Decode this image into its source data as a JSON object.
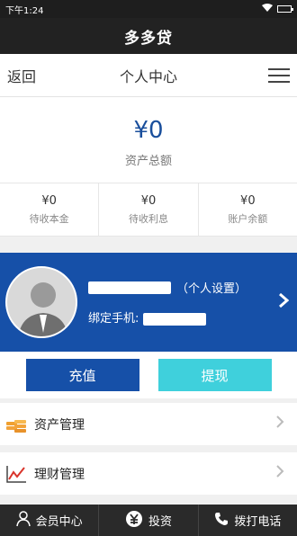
{
  "status": {
    "time": "下午1:24"
  },
  "app": {
    "title": "多多贷"
  },
  "nav": {
    "back": "返回",
    "title": "个人中心"
  },
  "assets": {
    "total_value": "¥0",
    "total_label": "资产总额"
  },
  "stats": [
    {
      "value": "¥0",
      "label": "待收本金"
    },
    {
      "value": "¥0",
      "label": "待收利息"
    },
    {
      "value": "¥0",
      "label": "账户余额"
    }
  ],
  "profile": {
    "settings": "（个人设置）",
    "phone_label": "绑定手机:"
  },
  "buttons": {
    "recharge": "充值",
    "withdraw": "提现"
  },
  "menu": [
    {
      "label": "资产管理",
      "icon": "coins-icon"
    },
    {
      "label": "理财管理",
      "icon": "chart-icon"
    }
  ],
  "tabs": [
    {
      "label": "会员中心",
      "icon": "person-icon"
    },
    {
      "label": "投资",
      "icon": "money-icon"
    },
    {
      "label": "拨打电话",
      "icon": "phone-icon"
    }
  ],
  "colors": {
    "brand_blue": "#1650a8",
    "accent_cyan": "#3fd0dc"
  }
}
